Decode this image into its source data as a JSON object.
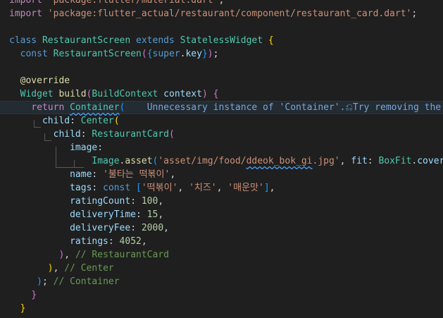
{
  "editor": {
    "theme": {
      "background": "#1f1f1f",
      "current_line": "#232b33",
      "keyword": "#569cd6",
      "control": "#c586c0",
      "string": "#ce9178",
      "type": "#4ec9b0",
      "function": "#dcdcaa",
      "variable": "#9cdcfe",
      "number": "#b5cea8",
      "comment": "#6a9955",
      "hint": "#7aa6d6"
    },
    "lines": [
      {
        "tokens": [
          {
            "t": "import",
            "c": "ctrl"
          },
          {
            "t": " ",
            "c": "punc"
          },
          {
            "t": "'package:flutter/material.dart'",
            "c": "str"
          },
          {
            "t": ";",
            "c": "punc"
          }
        ]
      },
      {
        "tokens": [
          {
            "t": "import",
            "c": "ctrl"
          },
          {
            "t": " ",
            "c": "punc"
          },
          {
            "t": "'package:flutter_actual/restaurant/component/restaurant_card.dart'",
            "c": "str"
          },
          {
            "t": ";",
            "c": "punc"
          }
        ]
      },
      {
        "tokens": []
      },
      {
        "tokens": [
          {
            "t": "class",
            "c": "kw"
          },
          {
            "t": " ",
            "c": "punc"
          },
          {
            "t": "RestaurantScreen",
            "c": "type"
          },
          {
            "t": " ",
            "c": "punc"
          },
          {
            "t": "extends",
            "c": "kw"
          },
          {
            "t": " ",
            "c": "punc"
          },
          {
            "t": "StatelessWidget",
            "c": "type"
          },
          {
            "t": " ",
            "c": "punc"
          },
          {
            "t": "{",
            "c": "b1"
          }
        ]
      },
      {
        "tokens": [
          {
            "t": "  ",
            "c": "punc"
          },
          {
            "t": "const",
            "c": "kw"
          },
          {
            "t": " ",
            "c": "punc"
          },
          {
            "t": "RestaurantScreen",
            "c": "type"
          },
          {
            "t": "(",
            "c": "b2"
          },
          {
            "t": "{",
            "c": "b3"
          },
          {
            "t": "super",
            "c": "kw"
          },
          {
            "t": ".",
            "c": "punc"
          },
          {
            "t": "key",
            "c": "var"
          },
          {
            "t": "}",
            "c": "b3"
          },
          {
            "t": ")",
            "c": "b2"
          },
          {
            "t": ";",
            "c": "punc"
          }
        ]
      },
      {
        "tokens": []
      },
      {
        "tokens": [
          {
            "t": "  ",
            "c": "punc"
          },
          {
            "t": "@override",
            "c": "meta"
          }
        ]
      },
      {
        "tokens": [
          {
            "t": "  ",
            "c": "punc"
          },
          {
            "t": "Widget",
            "c": "type"
          },
          {
            "t": " ",
            "c": "punc"
          },
          {
            "t": "build",
            "c": "fn"
          },
          {
            "t": "(",
            "c": "b2"
          },
          {
            "t": "BuildContext",
            "c": "type"
          },
          {
            "t": " ",
            "c": "punc"
          },
          {
            "t": "context",
            "c": "var"
          },
          {
            "t": ")",
            "c": "b2"
          },
          {
            "t": " ",
            "c": "punc"
          },
          {
            "t": "{",
            "c": "b2"
          }
        ]
      },
      {
        "current": true,
        "tokens": [
          {
            "t": "    ",
            "c": "punc"
          },
          {
            "t": "return",
            "c": "ctrl"
          },
          {
            "t": " ",
            "c": "punc"
          },
          {
            "t": "Container",
            "c": "type",
            "warn": true
          },
          {
            "t": "(",
            "c": "b3"
          },
          {
            "t": "    Unnecessary instance of 'Container'.",
            "c": "hint"
          },
          {
            "t": "⎌",
            "c": "hint",
            "icon": "lightbulb-icon"
          },
          {
            "t": "Try removing the 'Container'",
            "c": "hint"
          }
        ]
      },
      {
        "tokens": [
          {
            "t": "      ",
            "c": "punc"
          },
          {
            "t": "child",
            "c": "var"
          },
          {
            "t": ": ",
            "c": "punc"
          },
          {
            "t": "Center",
            "c": "type"
          },
          {
            "t": "(",
            "c": "b1"
          }
        ]
      },
      {
        "tokens": [
          {
            "t": "        ",
            "c": "punc"
          },
          {
            "t": "child",
            "c": "var"
          },
          {
            "t": ": ",
            "c": "punc"
          },
          {
            "t": "RestaurantCard",
            "c": "type"
          },
          {
            "t": "(",
            "c": "b2"
          }
        ]
      },
      {
        "tokens": [
          {
            "t": "          ",
            "c": "punc"
          },
          {
            "t": " image",
            "c": "var"
          },
          {
            "t": ":",
            "c": "punc"
          }
        ]
      },
      {
        "tokens": [
          {
            "t": "               ",
            "c": "punc"
          },
          {
            "t": "Image",
            "c": "type"
          },
          {
            "t": ".",
            "c": "punc"
          },
          {
            "t": "asset",
            "c": "fn"
          },
          {
            "t": "(",
            "c": "b3"
          },
          {
            "t": "'asset/img/food/",
            "c": "str"
          },
          {
            "t": "ddeok_bok_gi",
            "c": "str",
            "warn": true
          },
          {
            "t": ".jpg'",
            "c": "str"
          },
          {
            "t": ", ",
            "c": "punc"
          },
          {
            "t": "fit",
            "c": "var"
          },
          {
            "t": ": ",
            "c": "punc"
          },
          {
            "t": "BoxFit",
            "c": "type"
          },
          {
            "t": ".",
            "c": "punc"
          },
          {
            "t": "cover",
            "c": "var"
          },
          {
            "t": ")",
            "c": "b3"
          },
          {
            "t": ",",
            "c": "punc"
          }
        ]
      },
      {
        "tokens": [
          {
            "t": "           ",
            "c": "punc"
          },
          {
            "t": "name",
            "c": "var"
          },
          {
            "t": ": ",
            "c": "punc"
          },
          {
            "t": "'불타는 떡볶이'",
            "c": "str"
          },
          {
            "t": ",",
            "c": "punc"
          }
        ]
      },
      {
        "tokens": [
          {
            "t": "           ",
            "c": "punc"
          },
          {
            "t": "tags",
            "c": "var"
          },
          {
            "t": ": ",
            "c": "punc"
          },
          {
            "t": "const",
            "c": "kw"
          },
          {
            "t": " ",
            "c": "punc"
          },
          {
            "t": "[",
            "c": "b3"
          },
          {
            "t": "'떡볶이'",
            "c": "str"
          },
          {
            "t": ", ",
            "c": "punc"
          },
          {
            "t": "'치즈'",
            "c": "str"
          },
          {
            "t": ", ",
            "c": "punc"
          },
          {
            "t": "'매운맛'",
            "c": "str"
          },
          {
            "t": "]",
            "c": "b3"
          },
          {
            "t": ",",
            "c": "punc"
          }
        ]
      },
      {
        "tokens": [
          {
            "t": "           ",
            "c": "punc"
          },
          {
            "t": "ratingCount",
            "c": "var"
          },
          {
            "t": ": ",
            "c": "punc"
          },
          {
            "t": "100",
            "c": "num"
          },
          {
            "t": ",",
            "c": "punc"
          }
        ]
      },
      {
        "tokens": [
          {
            "t": "           ",
            "c": "punc"
          },
          {
            "t": "deliveryTime",
            "c": "var"
          },
          {
            "t": ": ",
            "c": "punc"
          },
          {
            "t": "15",
            "c": "num"
          },
          {
            "t": ",",
            "c": "punc"
          }
        ]
      },
      {
        "tokens": [
          {
            "t": "           ",
            "c": "punc"
          },
          {
            "t": "deliveryFee",
            "c": "var"
          },
          {
            "t": ": ",
            "c": "punc"
          },
          {
            "t": "2000",
            "c": "num"
          },
          {
            "t": ",",
            "c": "punc"
          }
        ]
      },
      {
        "tokens": [
          {
            "t": "           ",
            "c": "punc"
          },
          {
            "t": "ratings",
            "c": "var"
          },
          {
            "t": ": ",
            "c": "punc"
          },
          {
            "t": "4052",
            "c": "num"
          },
          {
            "t": ",",
            "c": "punc"
          }
        ]
      },
      {
        "tokens": [
          {
            "t": "         ",
            "c": "punc"
          },
          {
            "t": ")",
            "c": "b2"
          },
          {
            "t": ", ",
            "c": "punc"
          },
          {
            "t": "// RestaurantCard",
            "c": "comment"
          }
        ]
      },
      {
        "tokens": [
          {
            "t": "       ",
            "c": "punc"
          },
          {
            "t": ")",
            "c": "b1"
          },
          {
            "t": ", ",
            "c": "punc"
          },
          {
            "t": "// Center",
            "c": "comment"
          }
        ]
      },
      {
        "tokens": [
          {
            "t": "     ",
            "c": "punc"
          },
          {
            "t": ")",
            "c": "b3"
          },
          {
            "t": "; ",
            "c": "punc"
          },
          {
            "t": "// Container",
            "c": "comment"
          }
        ]
      },
      {
        "tokens": [
          {
            "t": "    ",
            "c": "punc"
          },
          {
            "t": "}",
            "c": "b2"
          }
        ]
      },
      {
        "tokens": [
          {
            "t": "  ",
            "c": "punc"
          },
          {
            "t": "}",
            "c": "b1"
          }
        ]
      }
    ]
  }
}
